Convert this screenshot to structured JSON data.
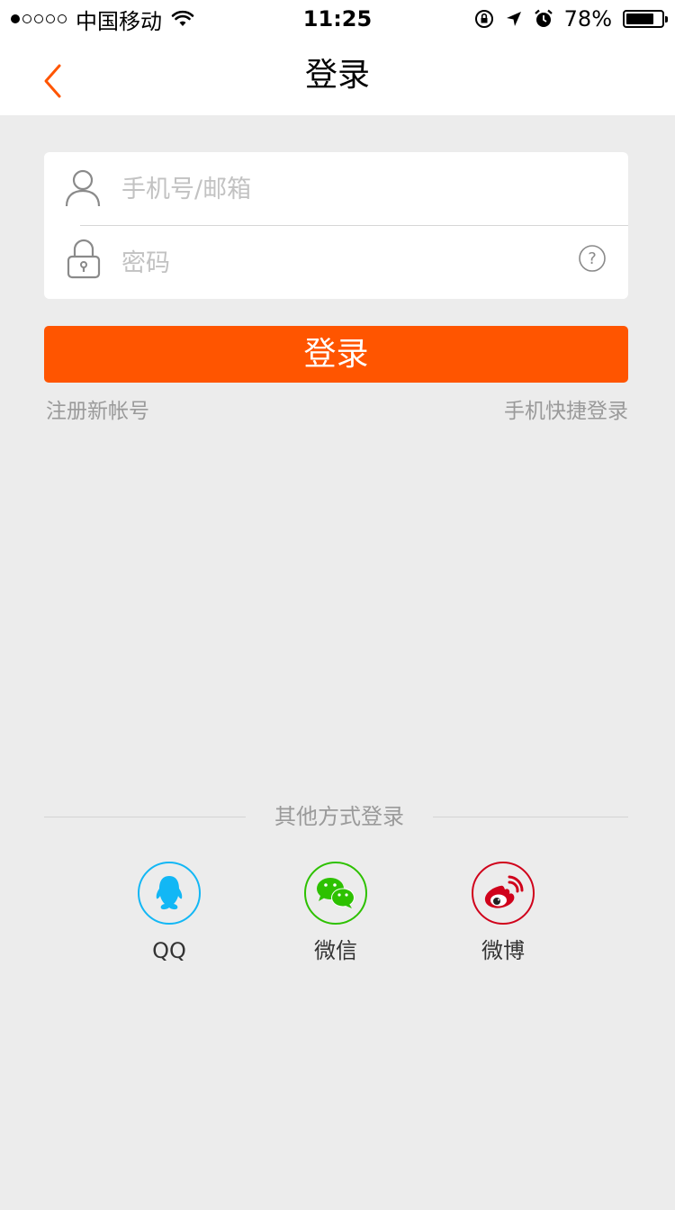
{
  "status_bar": {
    "carrier": "中国移动",
    "time": "11:25",
    "battery": "78%",
    "battery_level": 0.78,
    "signal_strength": 1
  },
  "nav": {
    "title": "登录",
    "back_icon": "chevron-left-icon"
  },
  "form": {
    "account_placeholder": "手机号/邮箱",
    "password_placeholder": "密码",
    "account_icon": "user-icon",
    "password_icon": "lock-icon",
    "help_icon": "question-icon"
  },
  "actions": {
    "login_label": "登录",
    "register_label": "注册新帐号",
    "quick_login_label": "手机快捷登录"
  },
  "social": {
    "title": "其他方式登录",
    "items": [
      {
        "label": "QQ",
        "icon": "qq-icon",
        "color": "#12b7f5"
      },
      {
        "label": "微信",
        "icon": "wechat-icon",
        "color": "#2dc100"
      },
      {
        "label": "微博",
        "icon": "weibo-icon",
        "color": "#d0021b"
      }
    ]
  },
  "colors": {
    "accent": "#ff5500",
    "background": "#ececec",
    "secondary_text": "#9a9a9a"
  }
}
